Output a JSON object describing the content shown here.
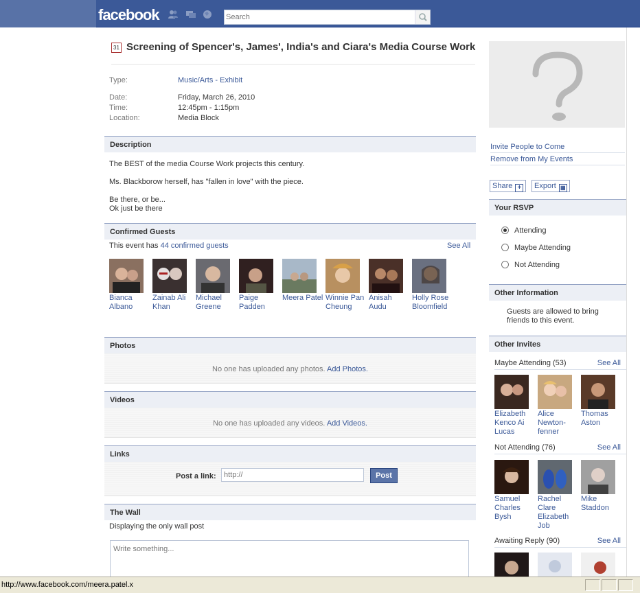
{
  "topbar": {
    "logo": "facebook",
    "search_placeholder": "Search"
  },
  "event": {
    "title": "Screening of Spencer's, James', India's and Ciara's Media Course Work",
    "type_label": "Type:",
    "type_value_1": "Music/Arts",
    "type_sep": " - ",
    "type_value_2": "Exhibit",
    "date_label": "Date:",
    "date_value": "Friday, March 26, 2010",
    "time_label": "Time:",
    "time_value": "12:45pm - 1:15pm",
    "location_label": "Location:",
    "location_value": "Media Block"
  },
  "description": {
    "header": "Description",
    "lines": [
      "The BEST of the media Course Work projects this century.",
      "Ms. Blackborow herself, has \"fallen in love\" with the piece.",
      "Be there, or be...",
      "Ok just be there"
    ]
  },
  "guests": {
    "header": "Confirmed Guests",
    "summary_prefix": "This event has ",
    "summary_link": "44 confirmed guests",
    "see_all": "See All",
    "items": [
      {
        "line1": "Bianca",
        "line2": "Albano"
      },
      {
        "line1": "Zainab Ali",
        "line2": "Khan"
      },
      {
        "line1": "Michael",
        "line2": "Greene"
      },
      {
        "line1": "Paige",
        "line2": "Padden"
      },
      {
        "line1": "Meera Patel",
        "line2": ""
      },
      {
        "line1": "Winnie Pan",
        "line2": "Cheung"
      },
      {
        "line1": "Anisah",
        "line2": "Audu"
      },
      {
        "line1": "Holly Rose",
        "line2": "Bloomfield"
      }
    ]
  },
  "photos": {
    "header": "Photos",
    "note": "No one has uploaded any photos.",
    "action": "Add Photos."
  },
  "videos": {
    "header": "Videos",
    "note": "No one has uploaded any videos.",
    "action": "Add Videos."
  },
  "links": {
    "header": "Links",
    "label": "Post a link:",
    "placeholder": "http://",
    "button": "Post"
  },
  "wall": {
    "header": "The Wall",
    "subtitle": "Displaying the only wall post",
    "placeholder": "Write something..."
  },
  "sidebar": {
    "invite": "Invite People to Come",
    "remove": "Remove from My Events",
    "share": "Share",
    "export": "Export",
    "rsvp_header": "Your RSVP",
    "rsvp_options": [
      "Attending",
      "Maybe Attending",
      "Not Attending"
    ],
    "rsvp_selected": "Attending",
    "other_info_header": "Other Information",
    "other_info_line1": "Guests are allowed to bring",
    "other_info_line2": "friends to this event.",
    "other_invites_header": "Other Invites",
    "maybe_title": "Maybe Attending (53)",
    "not_title": "Not Attending (76)",
    "awaiting_title": "Awaiting Reply (90)",
    "see_all": "See All",
    "maybe": [
      {
        "lines": [
          "Elizabeth",
          "Kenco Ai",
          "Lucas"
        ]
      },
      {
        "lines": [
          "Alice",
          "Newton-",
          "fenner"
        ]
      },
      {
        "lines": [
          "Thomas",
          "Aston",
          ""
        ]
      }
    ],
    "not": [
      {
        "lines": [
          "Samuel",
          "Charles",
          "Bysh",
          ""
        ]
      },
      {
        "lines": [
          "Rachel",
          "Clare",
          "Elizabeth",
          "Job"
        ]
      },
      {
        "lines": [
          "Mike",
          "Staddon",
          "",
          ""
        ]
      }
    ]
  },
  "statusbar": {
    "url": "http://www.facebook.com/meera.patel.x"
  },
  "colors": {
    "brand": "#3b5998",
    "header_bg": "#eceff5",
    "button": "#5b74a8"
  }
}
